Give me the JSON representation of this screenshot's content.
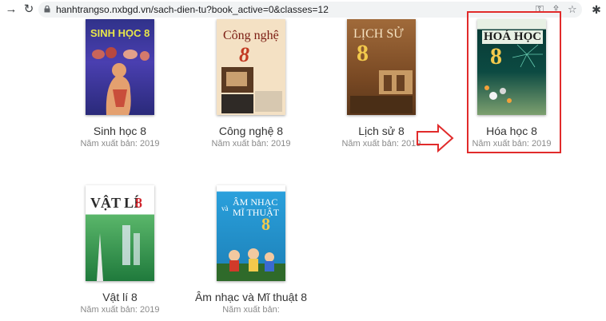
{
  "browser": {
    "url": "hanhtrangso.nxbgd.vn/sach-dien-tu?book_active=0&classes=12"
  },
  "books": [
    {
      "title": "Sinh học 8",
      "year": "Năm xuất bản: 2019",
      "cover_title": "SINH HỌC 8",
      "cover_color": "#2f2f86"
    },
    {
      "title": "Công nghệ 8",
      "year": "Năm xuất bản: 2019",
      "cover_title": "Công nghệ",
      "cover_number": "8",
      "cover_color": "#f4e1c4"
    },
    {
      "title": "Lịch sử 8",
      "year": "Năm xuất bản: 2019",
      "cover_title": "LỊCH SỬ",
      "cover_number": "8",
      "cover_color": "#8a5a2e"
    },
    {
      "title": "Hóa học 8",
      "year": "Năm xuất bản: 2019",
      "cover_title": "HOÁ HỌC",
      "cover_number": "8",
      "cover_color": "#0f3f3a"
    },
    {
      "title": "Vật lí 8",
      "year": "Năm xuất bản: 2019",
      "cover_title": "VẬT LÍ",
      "cover_number": "8",
      "cover_color": "#1f8a4a"
    },
    {
      "title": "Âm nhạc và Mĩ thuật 8",
      "year": "Năm xuất bản:",
      "cover_title_1": "ÂM NHẠC",
      "cover_title_2": "MĨ THUẬT",
      "cover_and": "và",
      "cover_number": "8",
      "cover_color": "#1f8fc8"
    }
  ],
  "annotation": {
    "highlight_color": "#e12b2b",
    "arrow_color": "#e12b2b"
  }
}
